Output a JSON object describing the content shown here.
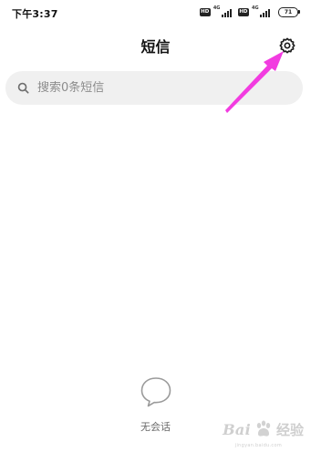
{
  "status_bar": {
    "time": "下午3:37",
    "sim1_hd": "HD",
    "sim1_net": "4G",
    "sim2_hd": "HD",
    "sim2_net": "4G",
    "battery": "71"
  },
  "header": {
    "title": "短信",
    "settings_icon": "gear-icon"
  },
  "search": {
    "placeholder": "搜索0条短信",
    "value": "",
    "icon": "search-icon"
  },
  "empty_state": {
    "icon": "chat-bubble-icon",
    "text": "无会话"
  },
  "annotation": {
    "arrow_color": "#f23ce0"
  },
  "watermark": {
    "brand": "Bai",
    "brand_suffix": "经验",
    "sub": "jingyan.baidu.com"
  }
}
